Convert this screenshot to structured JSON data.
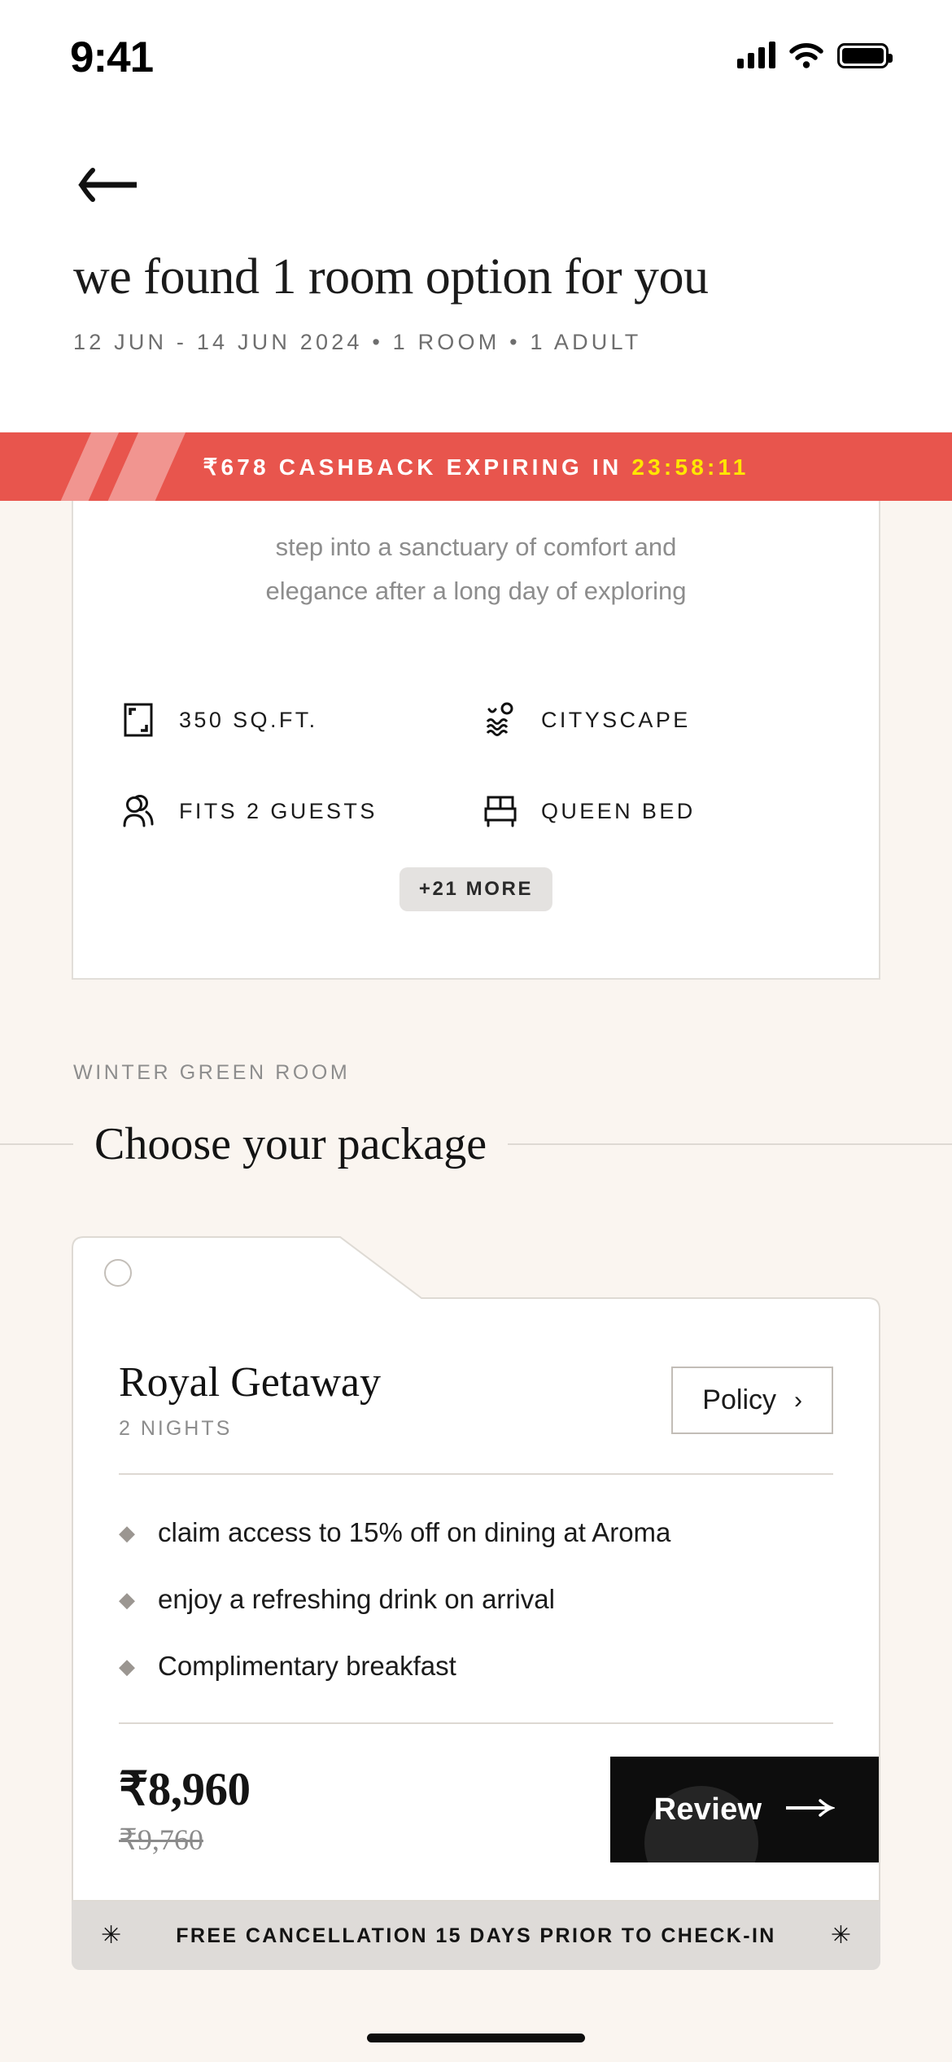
{
  "status_bar": {
    "time": "9:41",
    "signal_icon": "cellular-signal-icon",
    "wifi_icon": "wifi-icon",
    "battery_icon": "battery-icon"
  },
  "header": {
    "back_icon": "back-arrow-icon",
    "title": "we found 1 room option for you",
    "subtitle": "12 JUN - 14 JUN 2024 • 1 ROOM • 1 ADULT"
  },
  "cashback_banner": {
    "message": "₹678 CASHBACK EXPIRING IN",
    "timer": "23:58:11",
    "background_color": "#e8554d",
    "text_color": "#ffffff",
    "timer_color": "#ffe600"
  },
  "room_card": {
    "description_line_1": "step into a sanctuary of comfort and",
    "description_line_2": "elegance after a long day of exploring",
    "amenities": [
      {
        "label": "350 SQ.FT.",
        "icon": "area-size-icon"
      },
      {
        "label": "CITYSCAPE",
        "icon": "cityscape-view-icon"
      },
      {
        "label": "FITS 2 GUESTS",
        "icon": "guests-icon"
      },
      {
        "label": "QUEEN BED",
        "icon": "bed-icon"
      }
    ],
    "more_chip": "+21 MORE"
  },
  "section": {
    "eyebrow": "WINTER GREEN ROOM",
    "heading": "Choose your package"
  },
  "package": {
    "selected": false,
    "name": "Royal Getaway",
    "nights": "2 NIGHTS",
    "policy_label": "Policy",
    "policy_chevron": "chevron-right-icon",
    "benefits": [
      "claim access to 15% off on dining at Aroma",
      "enjoy a refreshing drink on arrival",
      "Complimentary breakfast"
    ],
    "bullet_glyph": "◆",
    "price": "₹8,960",
    "price_original": "₹9,760",
    "cta_label": "Review",
    "cta_icon": "arrow-right-icon",
    "cancellation_note": "FREE CANCELLATION 15 DAYS PRIOR TO CHECK-IN",
    "sparkle_glyph": "✳"
  }
}
